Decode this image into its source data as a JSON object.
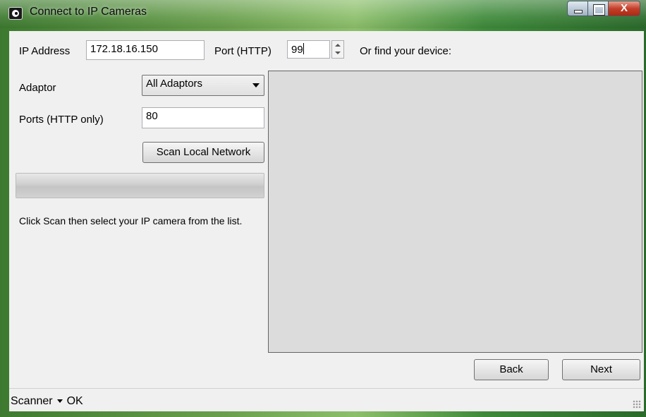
{
  "window": {
    "title": "Connect to IP Cameras",
    "close_glyph": "X"
  },
  "form": {
    "ip_label": "IP Address",
    "ip_value": "172.18.16.150",
    "port_label": "Port (HTTP)",
    "port_value": "99",
    "find_label": "Or find your device:",
    "adaptor_label": "Adaptor",
    "adaptor_value": "All Adaptors",
    "ports_label": "Ports (HTTP only)",
    "ports_value": "80",
    "scan_button": "Scan Local Network",
    "scan_progress": 0,
    "hint": "Click Scan then select your IP camera from the list."
  },
  "nav": {
    "back_label": "Back",
    "next_label": "Next"
  },
  "status": {
    "scanner_label": "Scanner",
    "state": "OK"
  },
  "colors": {
    "frame_accent": "#6aa04d",
    "dialog_bg": "#f0f0f0",
    "list_bg": "#dcdcdc"
  }
}
